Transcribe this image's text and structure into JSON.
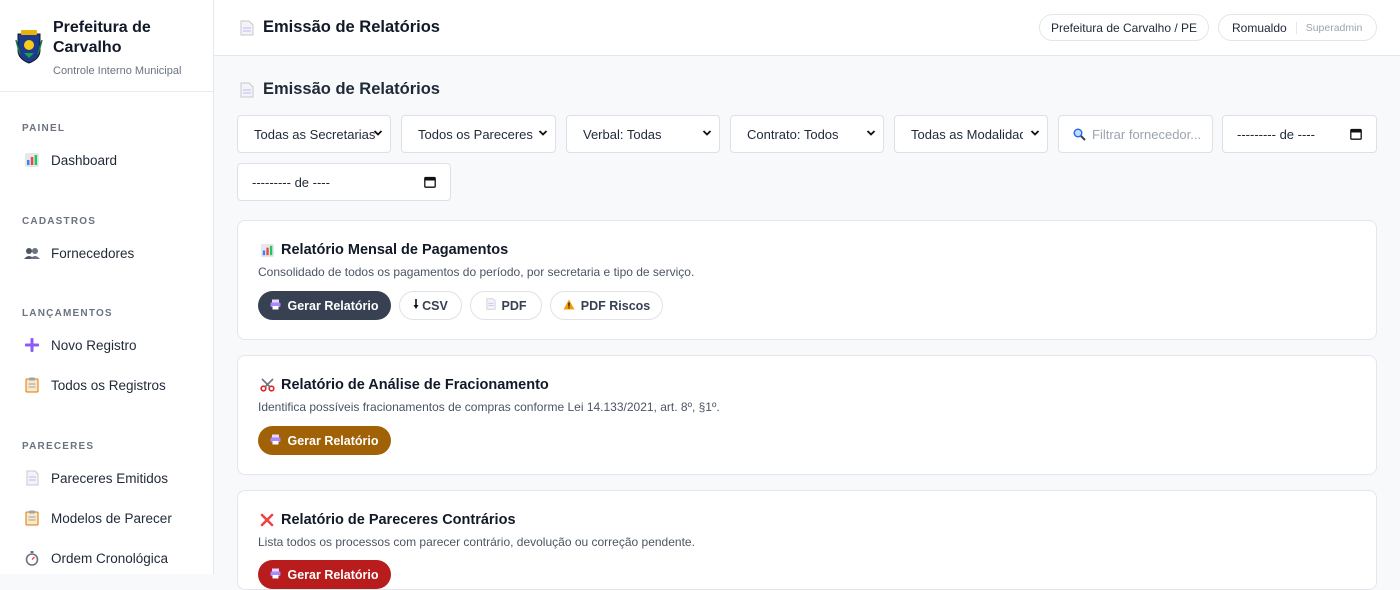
{
  "sidebar": {
    "brand_title": "Prefeitura de Carvalho",
    "brand_subtitle": "Controle Interno Municipal",
    "sections": {
      "painel": "PAINEL",
      "cadastros": "CADASTROS",
      "lancamentos": "LANÇAMENTOS",
      "pareceres": "PARECERES"
    },
    "items": {
      "dashboard": "Dashboard",
      "fornecedores": "Fornecedores",
      "novo_registro": "Novo Registro",
      "todos_registros": "Todos os Registros",
      "pareceres_emitidos": "Pareceres Emitidos",
      "modelos_parecer": "Modelos de Parecer",
      "ordem_cronologica": "Ordem Cronológica"
    }
  },
  "header": {
    "title": "Emissão de Relatórios",
    "org": "Prefeitura de Carvalho / PE",
    "user": "Romualdo",
    "role": "Superadmin"
  },
  "main": {
    "title": "Emissão de Relatórios",
    "filters": {
      "secretarias": "Todas as Secretarias",
      "pareceres": "Todos os Pareceres",
      "verbal": "Verbal: Todas",
      "contrato": "Contrato: Todos",
      "modalidades": "Todas as Modalidad",
      "search_placeholder": "Filtrar fornecedor...",
      "date_from": "--------- de ----",
      "date_to": "--------- de ----"
    },
    "cards": [
      {
        "title": "Relatório Mensal de Pagamentos",
        "description": "Consolidado de todos os pagamentos do período, por secretaria e tipo de serviço.",
        "buttons": {
          "gerar": "Gerar Relatório",
          "csv": "CSV",
          "pdf": "PDF",
          "pdf_riscos": "PDF Riscos"
        }
      },
      {
        "title": "Relatório de Análise de Fracionamento",
        "description": "Identifica possíveis fracionamentos de compras conforme Lei 14.133/2021, art. 8º, §1º.",
        "buttons": {
          "gerar": "Gerar Relatório"
        }
      },
      {
        "title": "Relatório de Pareceres Contrários",
        "description": "Lista todos os processos com parecer contrário, devolução ou correção pendente.",
        "buttons": {
          "gerar": "Gerar Relatório"
        }
      }
    ]
  },
  "colors": {
    "dark_button": "#374151",
    "gold_button": "#a16207",
    "red_button": "#b91c1c"
  }
}
